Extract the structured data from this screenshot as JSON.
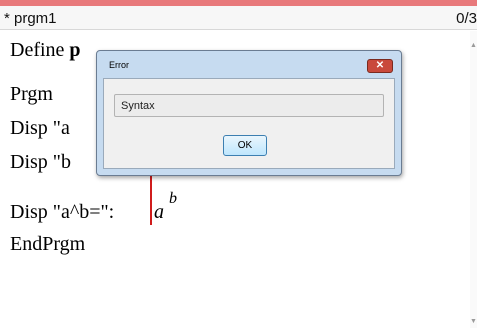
{
  "window": {
    "title": "* prgm1",
    "counter": "0/3"
  },
  "editor": {
    "lines": {
      "define": "Define ",
      "define_bold": "p",
      "prgm": "Prgm",
      "disp_a": "Disp \"a",
      "disp_b": "Disp \"b",
      "disp_pow": "Disp \"a^b=\":",
      "endprgm": "EndPrgm"
    },
    "math": {
      "base": "a",
      "exponent": "b"
    }
  },
  "dialog": {
    "title": "Error",
    "close_label": "✕",
    "message": "Syntax",
    "ok_label": "OK"
  }
}
